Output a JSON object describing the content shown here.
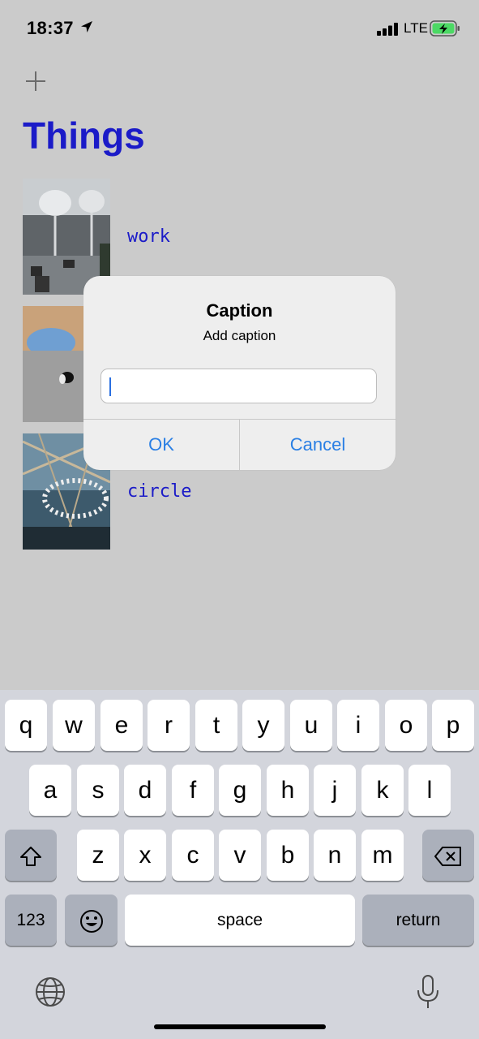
{
  "status_bar": {
    "time": "18:37",
    "network": "LTE"
  },
  "nav": {
    "title": "Things",
    "add_icon": "plus-icon"
  },
  "items": [
    {
      "caption": "work"
    },
    {
      "caption": ""
    },
    {
      "caption": "circle"
    }
  ],
  "alert": {
    "title": "Caption",
    "message": "Add caption",
    "input_value": "",
    "ok_label": "OK",
    "cancel_label": "Cancel"
  },
  "keyboard": {
    "row1": [
      "q",
      "w",
      "e",
      "r",
      "t",
      "y",
      "u",
      "i",
      "o",
      "p"
    ],
    "row2": [
      "a",
      "s",
      "d",
      "f",
      "g",
      "h",
      "j",
      "k",
      "l"
    ],
    "row3": [
      "z",
      "x",
      "c",
      "v",
      "b",
      "n",
      "m"
    ],
    "numbers_label": "123",
    "space_label": "space",
    "return_label": "return"
  },
  "colors": {
    "accent": "#1b1bc8",
    "alert_button": "#2a7fe4",
    "battery": "#4cd964"
  }
}
